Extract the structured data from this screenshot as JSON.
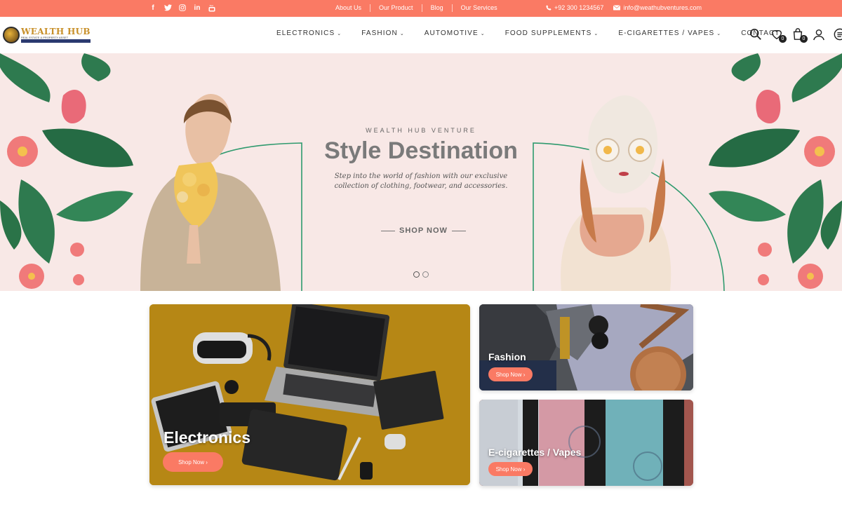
{
  "topbar": {
    "social_icons": [
      "facebook-icon",
      "twitter-icon",
      "instagram-icon",
      "linkedin-icon",
      "youtube-icon"
    ],
    "links": [
      "About Us",
      "Our Product",
      "Blog",
      "Our Services"
    ],
    "phone": "+92 300 1234567",
    "email": "info@weathubventures.com",
    "bg_color": "#fa7a64"
  },
  "header": {
    "logo_text": "WEALTH HUB",
    "logo_sub": "REAL ESTATE & PROPERTY ASSET",
    "nav": [
      "ELECTRONICS",
      "FASHION",
      "AUTOMOTIVE",
      "FOOD SUPPLEMENTS",
      "E-CIGARETTES / VAPES",
      "CONTACT"
    ],
    "wishlist_count": "0",
    "cart_count": "0"
  },
  "hero": {
    "kicker": "WEALTH HUB VENTURE",
    "title": "Style Destination",
    "desc_line1": "Step into the world of fashion with our exclusive",
    "desc_line2": "collection of clothing, footwear, and accessories.",
    "cta": "SHOP NOW",
    "slides": 2,
    "active_slide": 1
  },
  "cards": {
    "electronics": {
      "title": "Electronics",
      "button": "Shop Now ›"
    },
    "fashion": {
      "title": "Fashion",
      "button": "Shop Now ›"
    },
    "ecig": {
      "title": "E-cigarettes / Vapes",
      "button": "Shop Now ›"
    }
  },
  "colors": {
    "accent": "#fa7a64",
    "hero_bg": "#f8e8e6",
    "leaf": "#2e7a4f",
    "flower": "#f07a7a"
  }
}
